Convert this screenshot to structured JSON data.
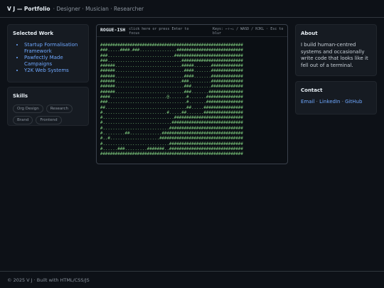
{
  "header": {
    "brand": "V J — Portfolio",
    "tagline": "· Designer · Musician · Researcher"
  },
  "selected_work": {
    "title": "Selected Work",
    "items": [
      {
        "label": "Startup Formalisation Framework"
      },
      {
        "label": "Pawfectly Made Campaigns"
      },
      {
        "label": "Y2K Web Systems"
      }
    ]
  },
  "skills": {
    "title": "Skills",
    "chips": [
      "Org Design",
      "Research",
      "Brand",
      "Frontend"
    ]
  },
  "game": {
    "title": "ROGUE-ISH",
    "hint": "click here or press Enter to focus",
    "keys": "Keys: ←↑→↓ / WASD / HJKL · Esc to blur",
    "map": [
      "##########################################################",
      "###.....####.###...............###########################",
      "###...........................############################",
      "###..............................#########################",
      "######...........................#####.......#############",
      "######............................####.......#############",
      "######............................####.......#############",
      "######...........................###.........#############",
      "######............................###........#############",
      "######............................###.......##############",
      "####.......................@.......#.......###############",
      "###................................#.......###############",
      "##.................................##.....################",
      "#..........................#.....##.......################",
      "#.............................############################",
      "#............................#############################",
      "#...........................##############################",
      "#.........##.............#################################",
      "#..#....................##################################",
      "#...........................##############################",
      "#......###.........#######..##############################",
      "##########################################################"
    ]
  },
  "about": {
    "title": "About",
    "text": "I build human-centred systems and occasionally write code that looks like it fell out of a terminal."
  },
  "contact": {
    "title": "Contact",
    "links": [
      "Email",
      "LinkedIn",
      "GitHub"
    ]
  },
  "footer": {
    "text": "© 2025 V J · Built with HTML/CSS/JS"
  }
}
